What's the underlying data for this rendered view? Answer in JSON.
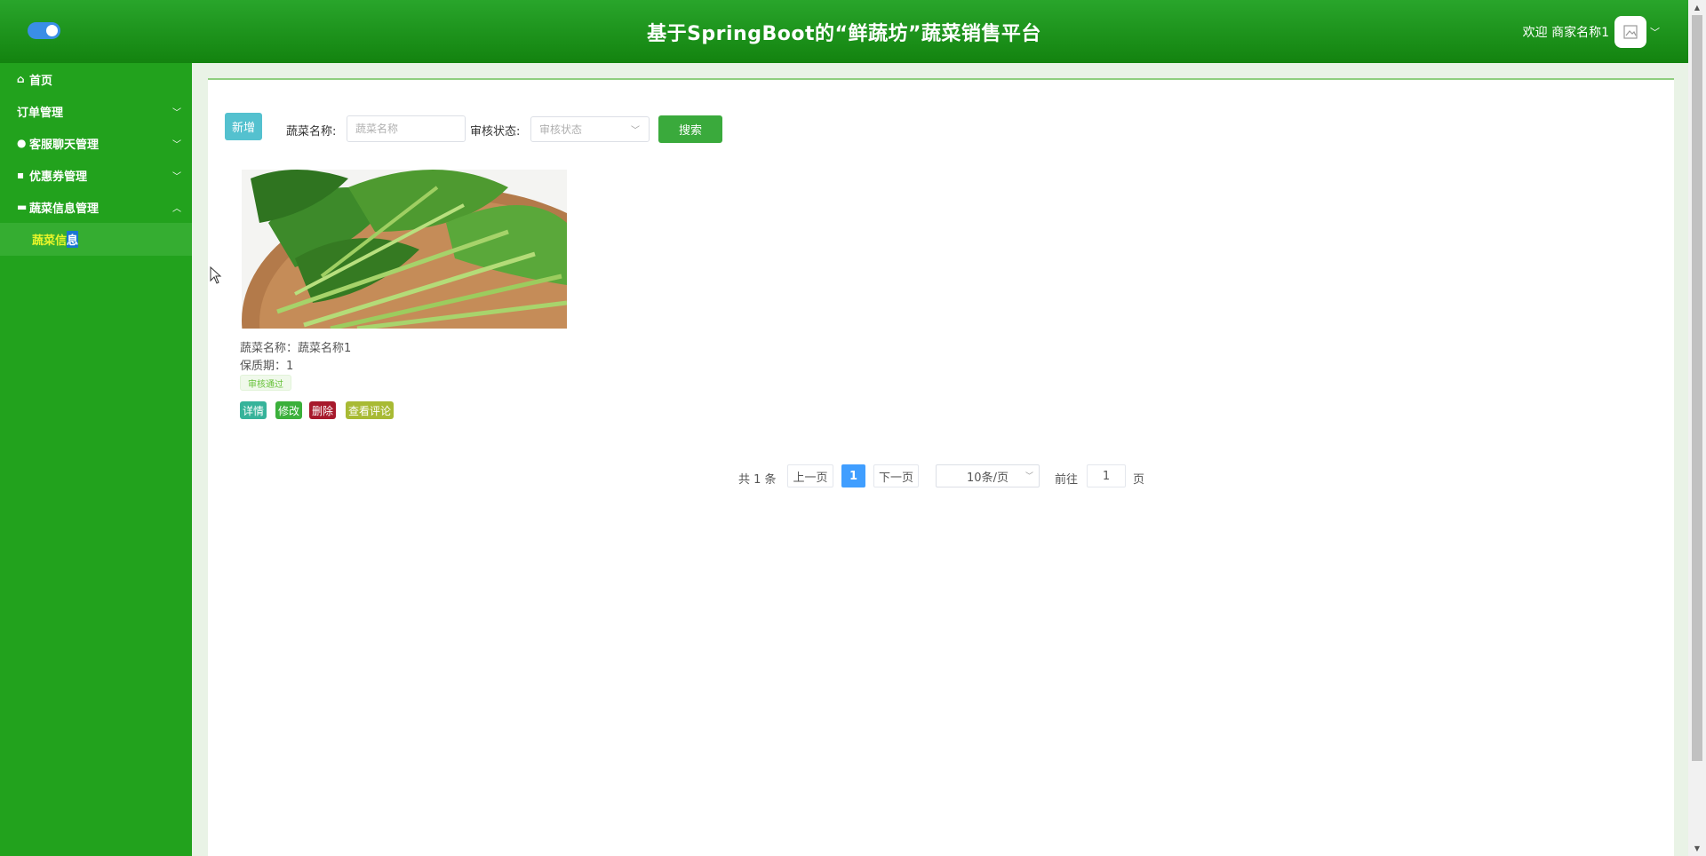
{
  "header": {
    "title": "基于SpringBoot的“鲜蔬坊”蔬菜销售平台",
    "welcome": "欢迎 商家名称1"
  },
  "sidebar": {
    "items": [
      {
        "label": "首页",
        "icon": "home-icon"
      },
      {
        "label": "订单管理",
        "icon": "",
        "expanded": false
      },
      {
        "label": "客服聊天管理",
        "icon": "chat-icon",
        "expanded": false
      },
      {
        "label": "优惠券管理",
        "icon": "coupon-icon",
        "expanded": false
      },
      {
        "label": "蔬菜信息管理",
        "icon": "list-icon",
        "expanded": true
      }
    ],
    "active_sub": {
      "label_a": "蔬菜信",
      "label_b": "息"
    }
  },
  "toolbar": {
    "add_label": "新增",
    "name_label": "蔬菜名称:",
    "name_placeholder": "蔬菜名称",
    "status_label": "审核状态:",
    "status_placeholder": "审核状态",
    "search_label": "搜索"
  },
  "cards": [
    {
      "name": "蔬菜名称：蔬菜名称1",
      "shelf_life": "保质期：1",
      "status": "审核通过",
      "actions": {
        "detail": "详情",
        "edit": "修改",
        "delete": "删除",
        "reviews": "查看评论"
      }
    }
  ],
  "pagination": {
    "total": "共 1 条",
    "prev": "上一页",
    "current": "1",
    "next": "下一页",
    "page_size": "10条/页",
    "goto": "前往",
    "goto_value": "1",
    "page_unit": "页"
  },
  "colors": {
    "header_top": "#29a52b",
    "sidebar": "#22a21d",
    "primary_blue": "#409eff",
    "search_green": "#3aaa3c"
  }
}
